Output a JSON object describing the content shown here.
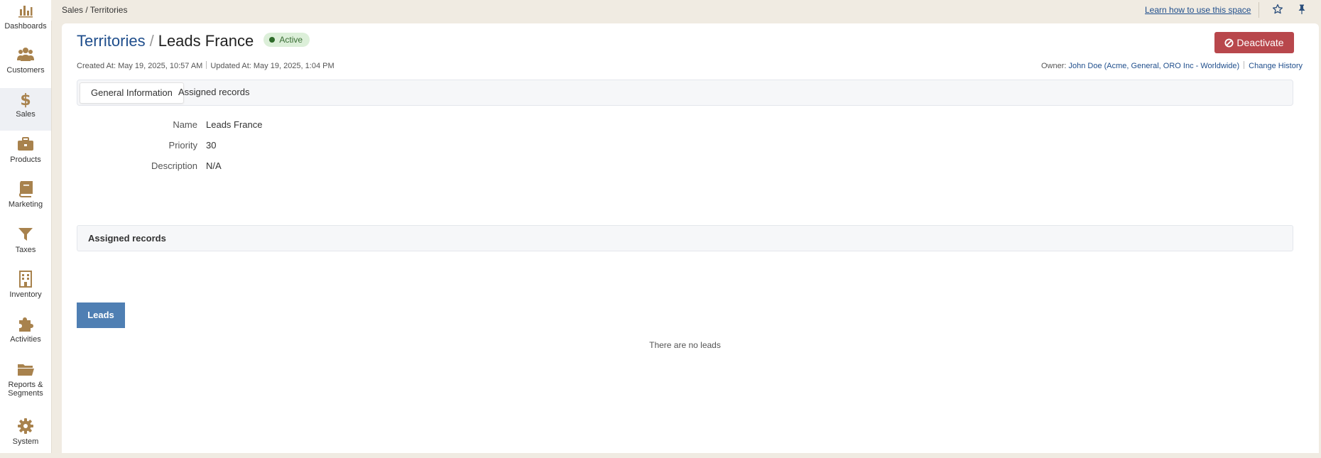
{
  "nav": {
    "items": [
      {
        "label": "Dashboards",
        "icon": "bar-chart-icon",
        "active": false
      },
      {
        "label": "Customers",
        "icon": "users-icon",
        "active": false
      },
      {
        "label": "Sales",
        "icon": "dollar-icon",
        "active": true
      },
      {
        "label": "Products",
        "icon": "briefcase-icon",
        "active": false
      },
      {
        "label": "Marketing",
        "icon": "book-icon",
        "active": false
      },
      {
        "label": "Taxes",
        "icon": "filter-icon",
        "active": false
      },
      {
        "label": "Inventory",
        "icon": "building-icon",
        "active": false
      },
      {
        "label": "Activities",
        "icon": "puzzle-icon",
        "active": false
      },
      {
        "label": "Reports & Segments",
        "icon": "folder-icon",
        "active": false
      },
      {
        "label": "System",
        "icon": "gear-icon",
        "active": false
      }
    ]
  },
  "topbar": {
    "breadcrumb": "Sales / Territories",
    "learn_link": "Learn how to use this space",
    "star_icon": "star-icon",
    "pin_icon": "pin-icon"
  },
  "page": {
    "crumb": "Territories",
    "separator": "/",
    "title": "Leads France",
    "status": "Active",
    "deactivate_label": "Deactivate",
    "created_at": "Created At: May 19, 2025, 10:57 AM",
    "updated_at": "Updated At: May 19, 2025, 1:04 PM",
    "owner_label": "Owner:",
    "owner_value": "John Doe (Acme, General, ORO Inc - Worldwide)",
    "change_history": "Change History"
  },
  "tabs": [
    {
      "label": "General Information",
      "active": true
    },
    {
      "label": "Assigned records",
      "active": false
    }
  ],
  "fields": [
    {
      "label": "Name",
      "value": "Leads France"
    },
    {
      "label": "Priority",
      "value": "30"
    },
    {
      "label": "Description",
      "value": "N/A"
    }
  ],
  "assigned": {
    "heading": "Assigned records",
    "leads_tab": "Leads",
    "empty_text": "There are no leads"
  },
  "colors": {
    "accent": "#1f4e8c",
    "icon_brown": "#a8824d",
    "danger": "#b8474c",
    "leads_button": "#4f7fb3",
    "status_bg": "#dcefd9"
  }
}
